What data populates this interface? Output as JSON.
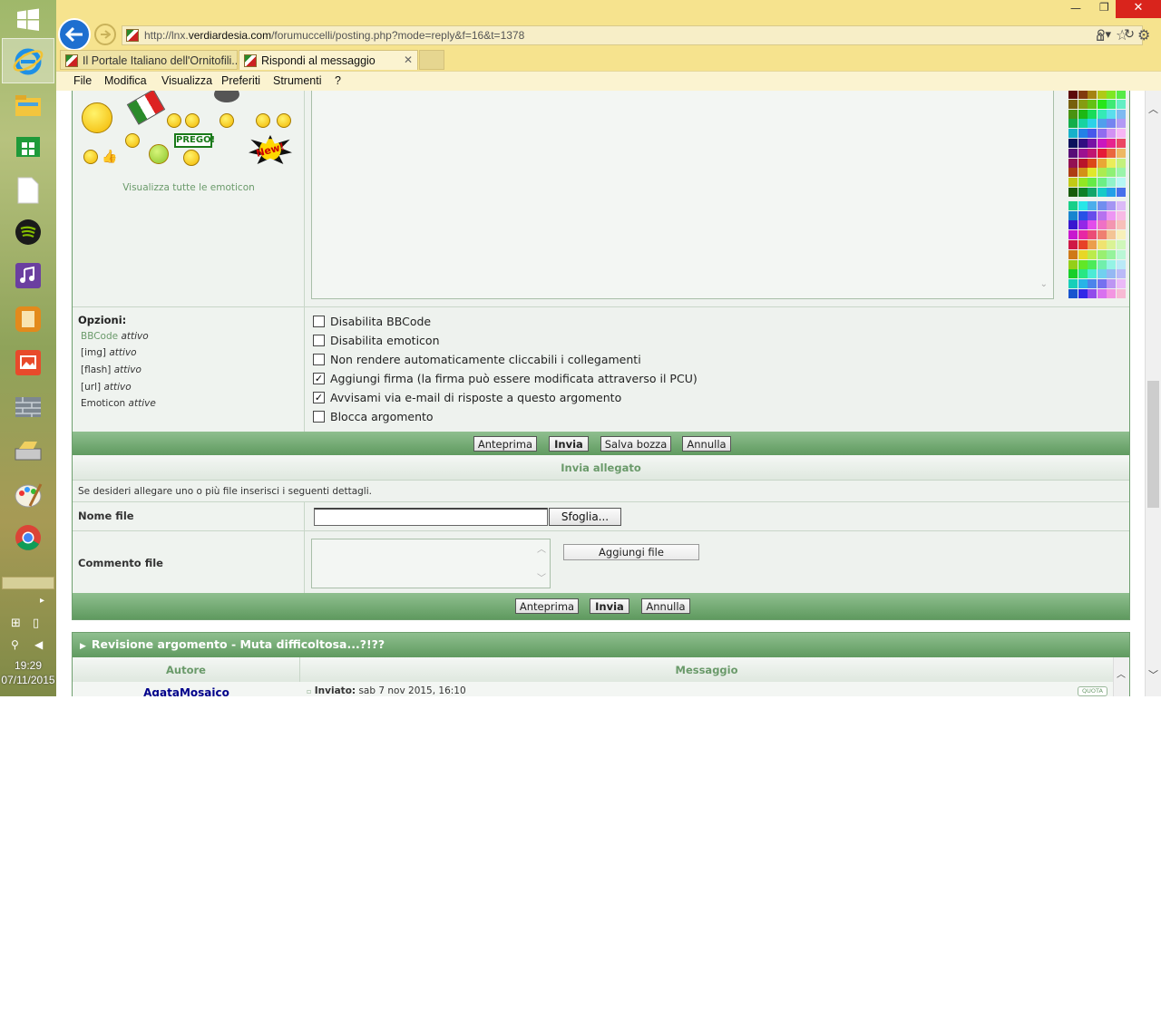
{
  "browser": {
    "url_prefix": "http://lnx.",
    "url_domain": "verdiardesia.com",
    "url_path": "/forumuccelli/posting.php?mode=reply&f=16&t=1378",
    "tabs": [
      {
        "label": "Il Portale Italiano dell'Ornitofili..."
      },
      {
        "label": "Rispondi al messaggio"
      }
    ],
    "menu": [
      "File",
      "Modifica",
      "Visualizza",
      "Preferiti",
      "Strumenti",
      "?"
    ]
  },
  "taskbar": {
    "time": "19:29",
    "date": "07/11/2015"
  },
  "emoticons": {
    "view_all_label": "Visualizza tutte le emoticon",
    "prego_text": "PREGO!",
    "new_text": "New!"
  },
  "options": {
    "title": "Opzioni:",
    "status": [
      {
        "name": "BBCode",
        "state": "attivo"
      },
      {
        "name": "[img]",
        "state": "attivo"
      },
      {
        "name": "[flash]",
        "state": "attivo"
      },
      {
        "name": "[url]",
        "state": "attivo"
      },
      {
        "name": "Emoticon",
        "state": "attive"
      }
    ],
    "checkboxes": [
      {
        "label": "Disabilita BBCode",
        "checked": false
      },
      {
        "label": "Disabilita emoticon",
        "checked": false
      },
      {
        "label": "Non rendere automaticamente cliccabili i collegamenti",
        "checked": false
      },
      {
        "label": "Aggiungi firma (la firma può essere modificata attraverso il PCU)",
        "checked": true
      },
      {
        "label": "Avvisami via e-mail di risposte a questo argomento",
        "checked": true
      },
      {
        "label": "Blocca argomento",
        "checked": false
      }
    ]
  },
  "buttons1": {
    "preview": "Anteprima",
    "submit": "Invia",
    "save_draft": "Salva bozza",
    "cancel": "Annulla"
  },
  "attachment": {
    "title": "Invia allegato",
    "help": "Se desideri allegare uno o più file inserisci i seguenti dettagli.",
    "filename_label": "Nome file",
    "browse_label": "Sfoglia...",
    "comment_label": "Commento file",
    "add_label": "Aggiungi file"
  },
  "buttons2": {
    "preview": "Anteprima",
    "submit": "Invia",
    "cancel": "Annulla"
  },
  "review": {
    "title": "Revisione argomento - Muta difficoltosa...?!??",
    "col_author": "Autore",
    "col_message": "Messaggio",
    "author": "AgataMosaico",
    "posted_label": "Inviato:",
    "posted_value": "sab 7 nov 2015, 16:10",
    "quote_label": "QUOTA"
  },
  "colors": {
    "accent": "#5f9a5f",
    "link": "#6a9a6a",
    "author": "#00008b"
  }
}
